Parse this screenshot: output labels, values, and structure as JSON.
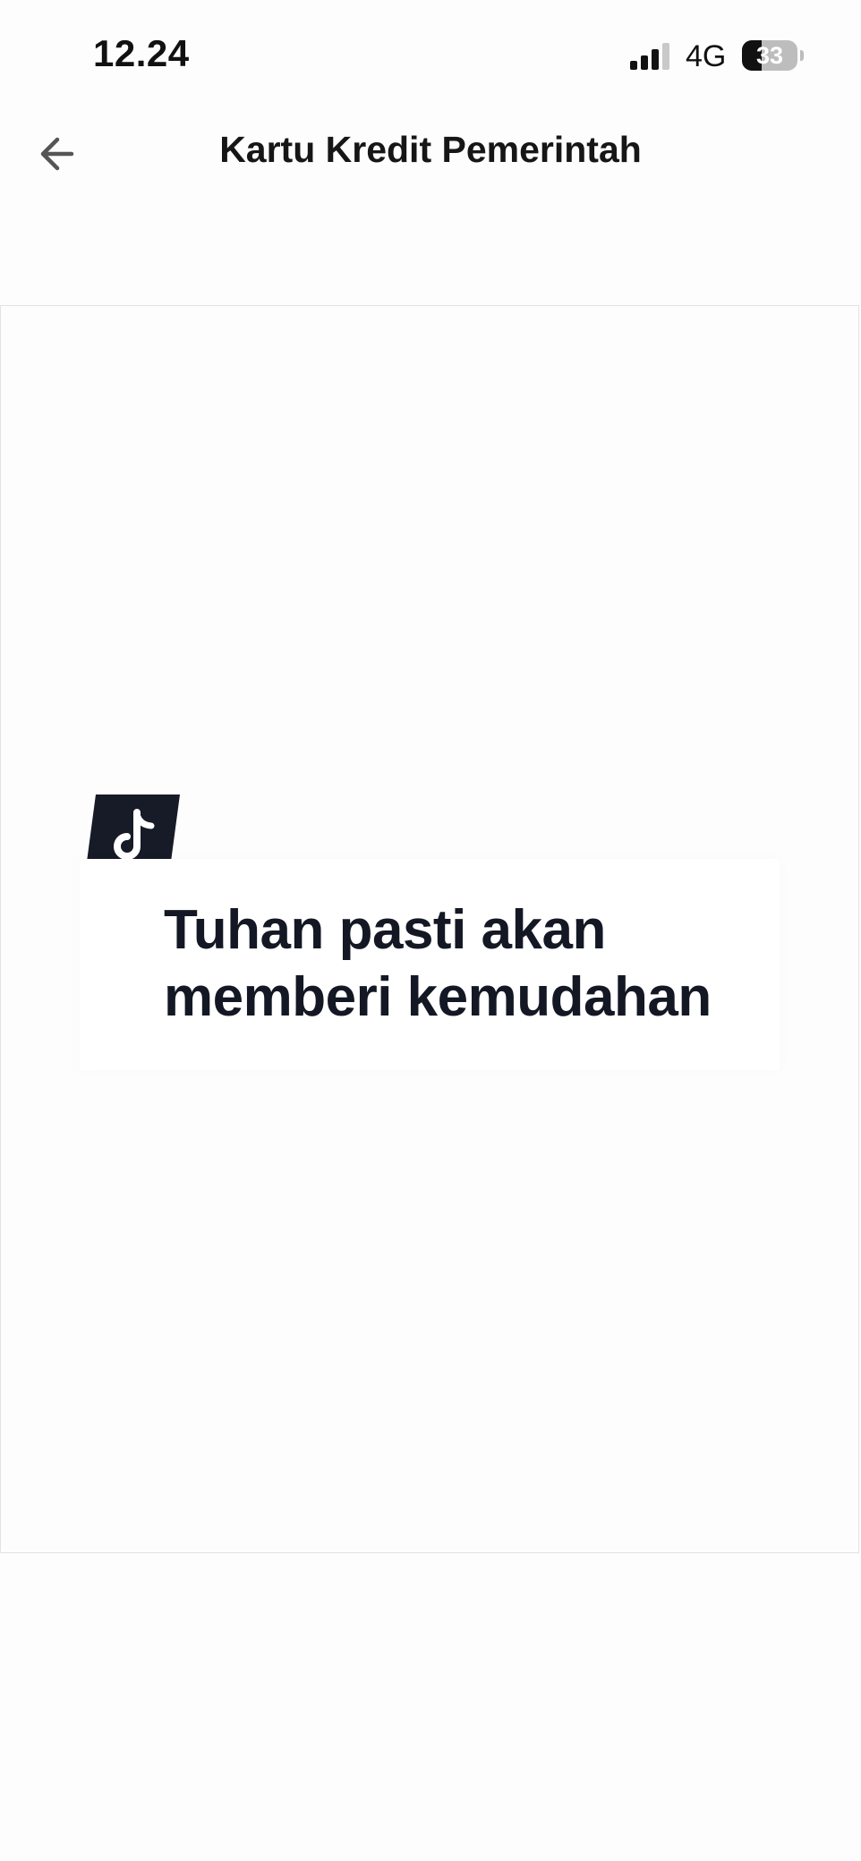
{
  "status_bar": {
    "time": "12.24",
    "network": "4G",
    "battery": "33"
  },
  "header": {
    "title": "Kartu Kredit Pemerintah",
    "back_icon": "arrow-left-icon"
  },
  "content": {
    "logo_icon": "tiktok-icon",
    "caption_line1": "Tuhan pasti akan",
    "caption_line2": "memberi kemudahan"
  }
}
